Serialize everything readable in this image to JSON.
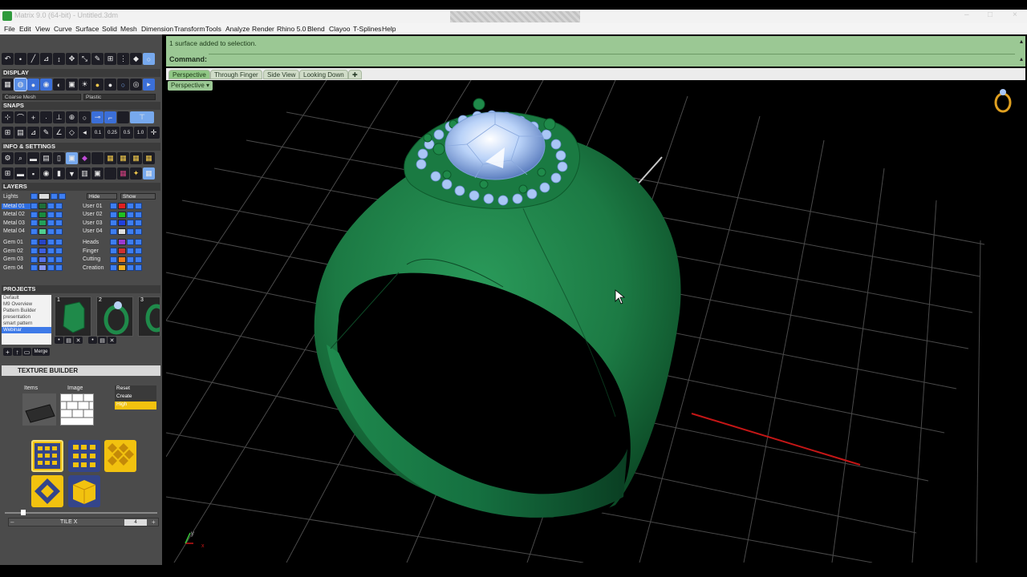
{
  "window": {
    "title": "Matrix 9.0 (64-bit) - Untitled.3dm",
    "controls": [
      "–",
      "□",
      "×"
    ]
  },
  "menu": [
    "File",
    "Edit",
    "View",
    "Curve",
    "Surface",
    "Solid",
    "Mesh",
    "Dimension",
    "Transform",
    "Tools",
    "Analyze",
    "Render",
    "Rhino 5.0",
    "Blend",
    "Clayoo",
    "T-Splines",
    "Help"
  ],
  "panel": {
    "display": {
      "title": "DISPLAY",
      "mesh_combo": "Coarse Mesh",
      "material_combo": "Plastic"
    },
    "snaps": {
      "title": "SNAPS",
      "values": [
        "0.1",
        "0.25",
        "0.5",
        "1.0"
      ]
    },
    "info": {
      "title": "INFO & SETTINGS"
    },
    "layers": {
      "title": "LAYERS",
      "lights_label": "Lights",
      "hide_label": "Hide",
      "show_label": "Show",
      "left": [
        {
          "name": "Metal 01",
          "color": "#1f6e3a",
          "selected": true
        },
        {
          "name": "Metal 02",
          "color": "#1a8a3e"
        },
        {
          "name": "Metal 03",
          "color": "#22a05a"
        },
        {
          "name": "Metal 04",
          "color": "#4fcf90"
        },
        {
          "name": "Gem 01",
          "color": "#2744c8"
        },
        {
          "name": "Gem 02",
          "color": "#3d5ee0"
        },
        {
          "name": "Gem 03",
          "color": "#5a74ea"
        },
        {
          "name": "Gem 04",
          "color": "#8895f0"
        }
      ],
      "right": [
        {
          "name": "User 01",
          "color": "#e02020"
        },
        {
          "name": "User 02",
          "color": "#20c020"
        },
        {
          "name": "User 03",
          "color": "#2040e0"
        },
        {
          "name": "User 04",
          "color": "#e0e0e0"
        },
        {
          "name": "Heads",
          "color": "#9b3ad0"
        },
        {
          "name": "Finger",
          "color": "#d03030"
        },
        {
          "name": "Cutting",
          "color": "#f07a18"
        },
        {
          "name": "Creation",
          "color": "#f5b11a"
        }
      ]
    },
    "projects": {
      "title": "PROJECTS",
      "items": [
        "Default",
        "M9 Overview",
        "Pattern Builder",
        "presentation",
        "smart pattern",
        "Webinar"
      ],
      "selected_index": 5,
      "thumb_numbers": [
        "1",
        "2",
        "3"
      ],
      "merge_label": "Merge"
    },
    "texture_builder": {
      "title": "TEXTURE BUILDER",
      "items_label": "Items",
      "image_label": "Image",
      "options": [
        "Reset",
        "Create",
        "High"
      ],
      "tile_label": "TILE X",
      "tile_value": "4"
    }
  },
  "command": {
    "history": "1 surface added to selection.",
    "label": "Command:",
    "value": ""
  },
  "viewport_tabs": [
    "Perspective",
    "Through Finger",
    "Side View",
    "Looking Down"
  ],
  "active_tab_index": 0,
  "viewport_label": "Perspective",
  "axis": {
    "y": "y",
    "x": "x"
  },
  "colors": {
    "ring": "#1e7f4a",
    "gem": "#a9c6f5",
    "grid": "#5a5a5a",
    "x_axis": "#c41616",
    "command_bg": "#9bc894"
  }
}
